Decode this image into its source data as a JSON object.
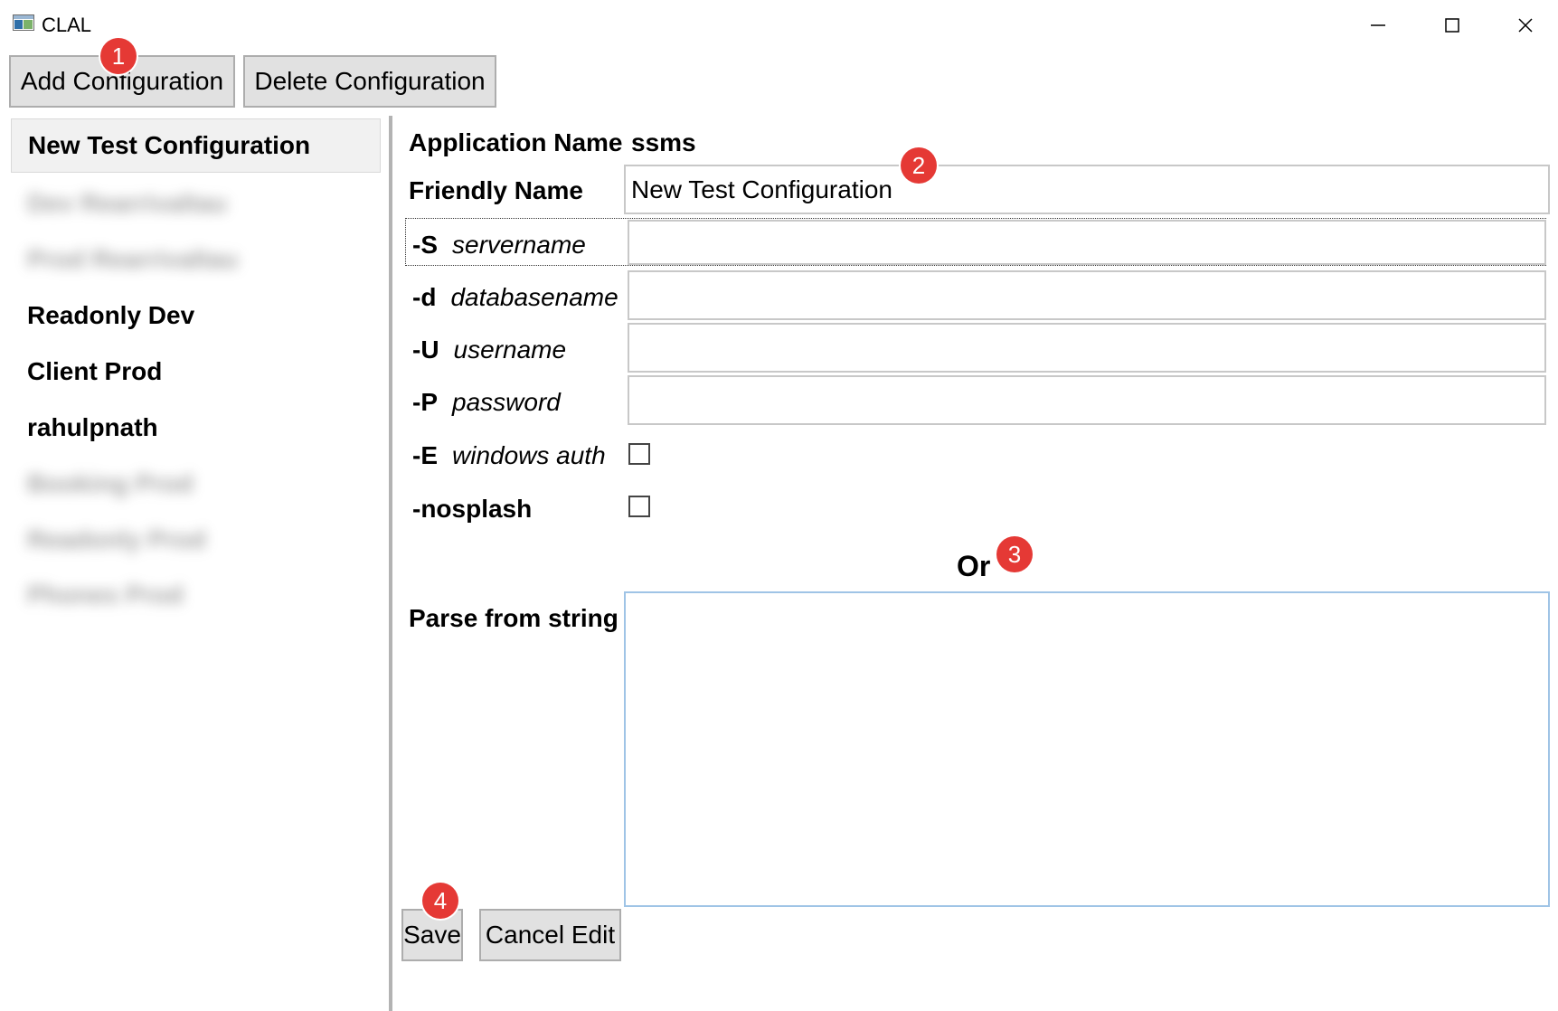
{
  "window": {
    "title": "CLAL",
    "icon": "app-window-icon",
    "controls": [
      "minimize-icon",
      "maximize-icon",
      "close-icon"
    ]
  },
  "toolbar": {
    "add_label": "Add Configuration",
    "delete_label": "Delete Configuration"
  },
  "sidebar": {
    "items": [
      {
        "label": "New Test Configuration",
        "selected": true,
        "blurred": false
      },
      {
        "label": "Dev Rearrivaltau",
        "selected": false,
        "blurred": true
      },
      {
        "label": "Prod Rearrivaltau",
        "selected": false,
        "blurred": true
      },
      {
        "label": "Readonly Dev",
        "selected": false,
        "blurred": false
      },
      {
        "label": "Client Prod",
        "selected": false,
        "blurred": false
      },
      {
        "label": "rahulpnath",
        "selected": false,
        "blurred": false
      },
      {
        "label": "Booking Prod",
        "selected": false,
        "blurred": true
      },
      {
        "label": "Readonly Prod",
        "selected": false,
        "blurred": true
      },
      {
        "label": "Phones Prod",
        "selected": false,
        "blurred": true
      }
    ]
  },
  "form": {
    "app_name_label": "Application Name",
    "app_name_value": "ssms",
    "friendly_name_label": "Friendly Name",
    "friendly_name_value": "New Test Configuration",
    "server": {
      "flag": "-S",
      "hint": "servername",
      "value": ""
    },
    "database": {
      "flag": "-d",
      "hint": "databasename",
      "value": ""
    },
    "username": {
      "flag": "-U",
      "hint": "username",
      "value": ""
    },
    "password": {
      "flag": "-P",
      "hint": "password",
      "value": ""
    },
    "windows_auth": {
      "flag": "-E",
      "hint": "windows auth",
      "checked": false
    },
    "nosplash": {
      "flag": "-nosplash",
      "checked": false
    },
    "or_label": "Or",
    "parse_label": "Parse from string",
    "parse_value": ""
  },
  "actions": {
    "save_label": "Save",
    "cancel_label": "Cancel Edit"
  },
  "annotations": [
    "1",
    "2",
    "3",
    "4"
  ],
  "colors": {
    "badge": "#e53935",
    "button_bg": "#e1e1e1",
    "button_border": "#adadad",
    "selected_bg": "#f1f1f1",
    "textarea_border": "#9fc4e6"
  }
}
